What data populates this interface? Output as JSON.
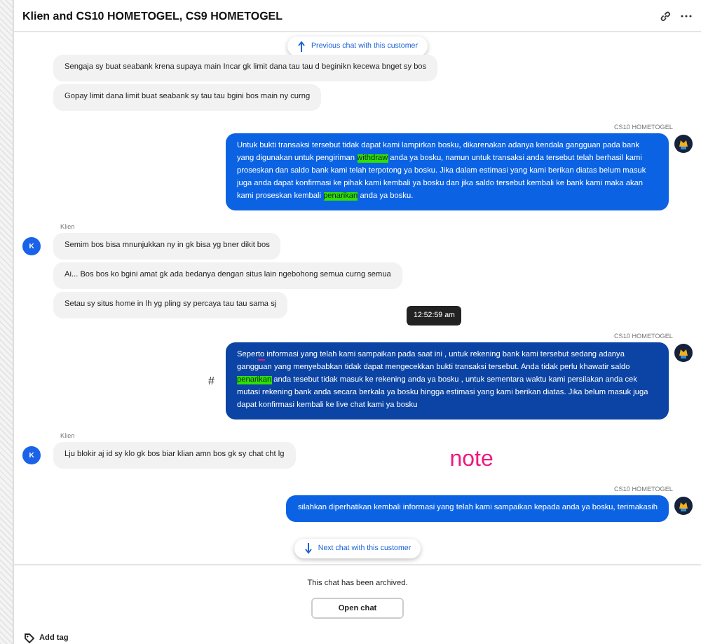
{
  "header": {
    "title": "Klien and CS10 HOMETOGEL, CS9 HOMETOGEL"
  },
  "previous_chat": {
    "label": "Previous chat with this customer"
  },
  "groups": [
    {
      "kind": "client",
      "messages": [
        {
          "parts": [
            {
              "text": "Sengaja sy buat seabank krena supaya main Incar gk limit dana tau tau d beginikn kecewa bnget sy bos"
            }
          ]
        },
        {
          "parts": [
            {
              "text": "Gopay limit dana limit buat seabank sy tau tau bgini bos main ny curng"
            }
          ]
        }
      ]
    },
    {
      "kind": "agent",
      "author": "CS10 HOMETOGEL",
      "messages": [
        {
          "hovered": false,
          "parts": [
            {
              "text": "Untuk bukti transaksi tersebut tidak dapat kami lampirkan bosku, dikarenakan adanya kendala gangguan pada bank yang digunakan untuk pengiriman "
            },
            {
              "text": "withdraw",
              "kind": "highlight"
            },
            {
              "text": " anda ya bosku, namun untuk transaksi anda tersebut telah berhasil kami proseskan dan saldo bank kami telah terpotong ya bosku. Jika dalam estimasi yang kami berikan diatas belum masuk juga anda dapat konfirmasi ke pihak kami kembali ya bosku dan jika saldo tersebut kembali ke bank kami maka akan kami proseskan kembali "
            },
            {
              "text": "penarikan",
              "kind": "highlight"
            },
            {
              "text": " anda ya bosku."
            }
          ]
        }
      ]
    },
    {
      "kind": "client",
      "author": "Klien",
      "avatar": "K",
      "messages": [
        {
          "parts": [
            {
              "text": "Semim bos bisa mnunjukkan ny in gk bisa yg bner dikit bos"
            }
          ]
        },
        {
          "parts": [
            {
              "text": "Ai... Bos bos ko bgini amat gk ada bedanya dengan situs lain ngebohong semua curng semua"
            }
          ]
        },
        {
          "parts": [
            {
              "text": "Setau sy situs home in lh yg pling sy percaya tau tau sama sj"
            }
          ]
        }
      ]
    },
    {
      "kind": "agent",
      "author": "CS10 HOMETOGEL",
      "tooltip": "12:52:59 am",
      "side_mark": "#",
      "messages": [
        {
          "hovered": true,
          "parts": [
            {
              "text": "Seper"
            },
            {
              "text": "to",
              "kind": "underline"
            },
            {
              "text": " informasi yang telah kami sampaikan pada saat ini , untuk rekening bank kami tersebut sedang adanya gangguan yang menyebabkan tidak dapat mengecekkan bukti transaksi tersebut. Anda tidak perlu khawatir saldo "
            },
            {
              "text": "penarikan",
              "kind": "highlight"
            },
            {
              "text": " anda tesebut tidak masuk ke rekening anda ya bosku , untuk sementara waktu kami persilakan anda cek mutasi rekening bank anda secara berkala ya bosku hingga estimasi yang kami berikan diatas. Jika belum masuk juga dapat konfirmasi kembali ke live chat kami ya bosku"
            }
          ]
        }
      ]
    },
    {
      "kind": "client",
      "author": "Klien",
      "avatar": "K",
      "note": "note",
      "messages": [
        {
          "parts": [
            {
              "text": "Lju blokir aj id sy klo gk bos biar klian amn bos gk sy chat cht lg"
            }
          ]
        }
      ]
    },
    {
      "kind": "agent",
      "author": "CS10 HOMETOGEL",
      "messages": [
        {
          "hovered": false,
          "parts": [
            {
              "text": "silahkan diperhatikan kembali informasi yang telah kami sampaikan kepada anda ya bosku, terimakasih"
            }
          ]
        }
      ]
    }
  ],
  "next_chat": {
    "label": "Next chat with this customer"
  },
  "footer": {
    "status": "This chat has been archived.",
    "button": "Open chat",
    "add_tag": "Add tag"
  }
}
